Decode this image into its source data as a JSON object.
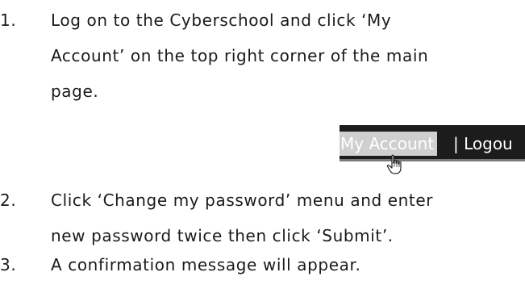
{
  "steps": [
    {
      "number": "1.",
      "lines": [
        "Log on to the Cyberschool and click ‘My",
        "Account’ on the top right corner of the main",
        "page."
      ]
    },
    {
      "number": "2.",
      "lines": [
        "Click ‘Change my password’ menu and enter",
        "new password twice then click ‘Submit’."
      ]
    },
    {
      "number": "3.",
      "lines": [
        "A confirmation message will appear."
      ]
    }
  ],
  "menu_bar": {
    "my_account": "My Account",
    "separator_logout": "| Logou"
  },
  "icons": {
    "cursor": "hand-pointer-icon"
  },
  "colors": {
    "menu_bg": "#1c1c1c",
    "highlight_bg": "#cfcfcf",
    "text": "#1a1a1a"
  }
}
